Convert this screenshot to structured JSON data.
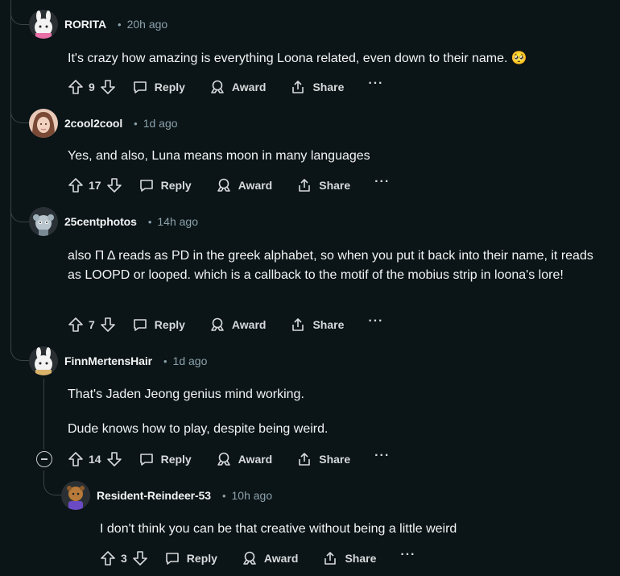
{
  "comments": [
    {
      "author": "RORITA",
      "time": "20h ago",
      "body": [
        "It's crazy how amazing is everything Loona related, even down to their name. 🥺"
      ],
      "score": "9"
    },
    {
      "author": "2cool2cool",
      "time": "1d ago",
      "body": [
        "Yes, and also, Luna means moon in many languages"
      ],
      "score": "17"
    },
    {
      "author": "25centphotos",
      "time": "14h ago",
      "body": [
        "also Π Δ  reads as PD in the greek alphabet, so when you put it back into their name, it reads as LOOPD or looped. which is a callback to the motif of the mobius strip in loona's lore!"
      ],
      "score": "7"
    },
    {
      "author": "FinnMertensHair",
      "time": "1d ago",
      "body": [
        "That's Jaden Jeong genius mind working.",
        "Dude knows how to play, despite being weird."
      ],
      "score": "14"
    },
    {
      "author": "Resident-Reindeer-53",
      "time": "10h ago",
      "body": [
        "I don't think you can be that creative without being a little weird"
      ],
      "score": "3"
    }
  ],
  "actions": {
    "reply": "Reply",
    "award": "Award",
    "share": "Share",
    "more": "···"
  },
  "separator": "•",
  "icons": {
    "upvote": "upvote-icon",
    "downvote": "downvote-icon",
    "reply": "comment-bubble-icon",
    "award": "award-icon",
    "share": "share-icon",
    "collapse": "minus-circle-icon"
  }
}
